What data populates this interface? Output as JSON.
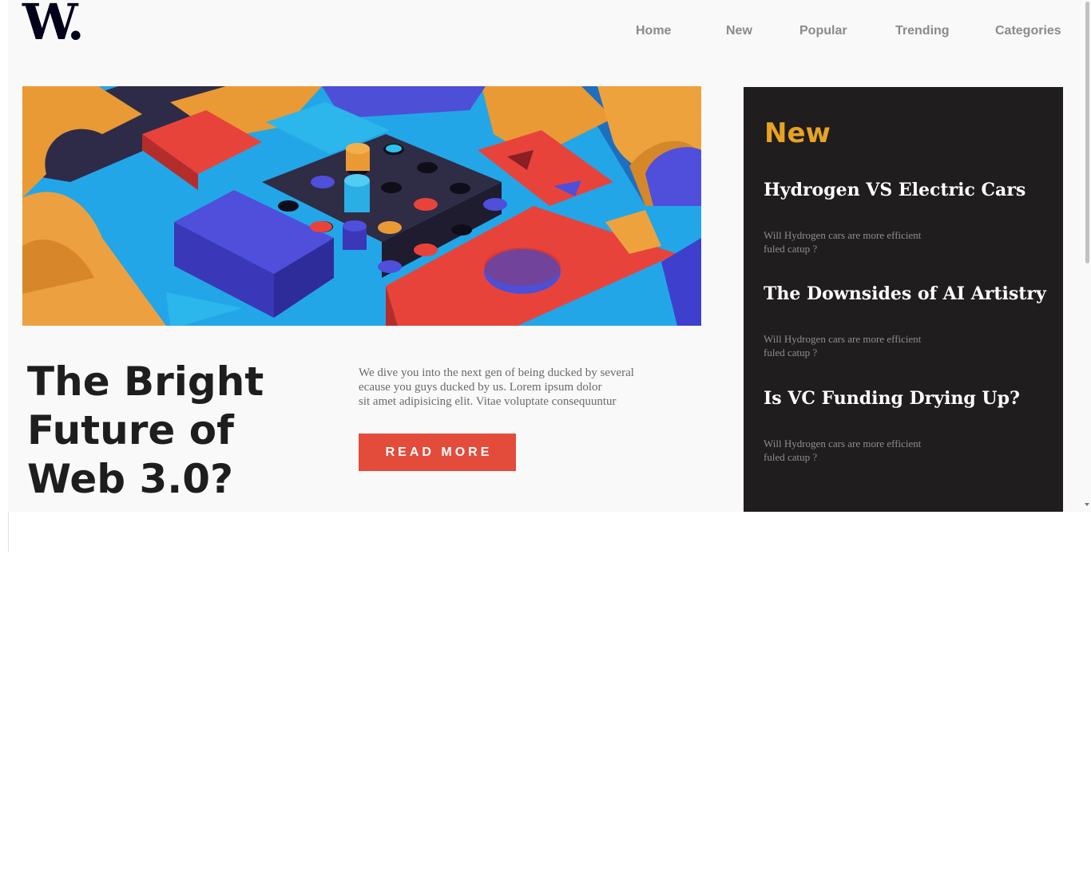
{
  "brand": {
    "logo_text": "W."
  },
  "nav": {
    "items": [
      {
        "label": "Home"
      },
      {
        "label": "New"
      },
      {
        "label": "Popular"
      },
      {
        "label": "Trending"
      },
      {
        "label": "Categories"
      }
    ]
  },
  "hero": {
    "image_icon": "abstract-3d-blocks-illustration",
    "headline_lines": [
      "The Bright",
      "Future of",
      "Web 3.0?"
    ],
    "intro_lines": [
      "We dive you into the next gen of being ducked by several",
      "ecause you guys ducked by us. Lorem ipsum dolor",
      "sit amet adipisicing elit. Vitae voluptate consequuntur"
    ],
    "read_more_label": "READ MORE"
  },
  "new_panel": {
    "title": "New",
    "stories": [
      {
        "title": "Hydrogen VS Electric Cars",
        "desc_lines": [
          "Will Hydrogen cars are more efficient",
          "fuled catup ?"
        ]
      },
      {
        "title": "The Downsides of AI Artistry",
        "desc_lines": [
          "Will Hydrogen cars are more efficient",
          "fuled catup ?"
        ]
      },
      {
        "title": "Is VC Funding Drying Up?",
        "desc_lines": [
          "Will Hydrogen cars are more efficient",
          "fuled catup ?"
        ]
      }
    ]
  },
  "colors": {
    "accent_red": "#e34c3a",
    "accent_gold": "#e8a325",
    "panel_dark": "#201d1e",
    "page_bg": "#f9f9f9"
  }
}
